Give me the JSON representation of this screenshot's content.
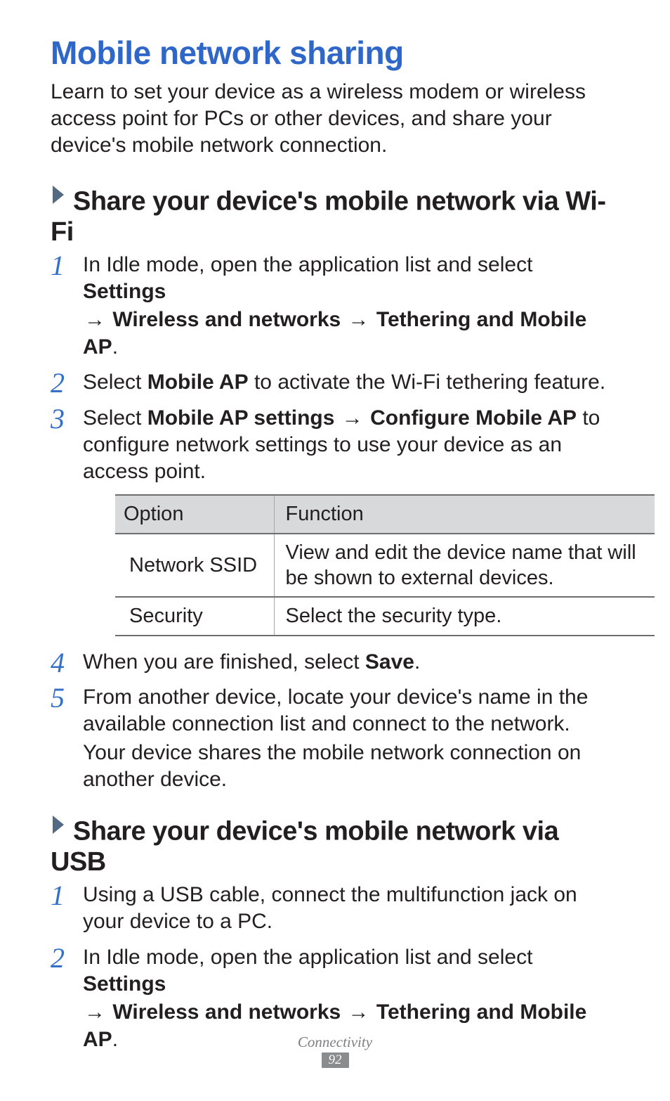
{
  "title": "Mobile network sharing",
  "intro": "Learn to set your device as a wireless modem or wireless access point for PCs or other devices, and share your device's mobile network connection.",
  "section1": {
    "heading": "Share your device's mobile network via Wi-Fi",
    "steps": {
      "s1_a": "In Idle mode, open the application list and select ",
      "s1_b": "Settings",
      "s1_c": "Wireless and networks",
      "s1_d": "Tethering and Mobile AP",
      "s1_e": ".",
      "s2_a": "Select ",
      "s2_b": "Mobile AP",
      "s2_c": " to activate the Wi-Fi tethering feature.",
      "s3_a": "Select ",
      "s3_b": "Mobile AP settings",
      "s3_c": "Configure Mobile AP",
      "s3_d": " to configure network settings to use your device as an access point.",
      "s4": "When you are finished, select ",
      "s4_b": "Save",
      "s4_c": ".",
      "s5_a": "From another device, locate your device's name in the available connection list and connect to the network.",
      "s5_b": "Your device shares the mobile network connection on another device."
    },
    "nums": {
      "n1": "1",
      "n2": "2",
      "n3": "3",
      "n4": "4",
      "n5": "5"
    }
  },
  "table": {
    "head": {
      "c1": "Option",
      "c2": "Function"
    },
    "rows": [
      {
        "c1": "Network SSID",
        "c2": "View and edit the device name that will be shown to external devices."
      },
      {
        "c1": "Security",
        "c2": "Select the security type."
      }
    ]
  },
  "section2": {
    "heading": "Share your device's mobile network via USB",
    "steps": {
      "s1": "Using a USB cable, connect the multifunction jack on your device to a PC.",
      "s2_a": "In Idle mode, open the application list and select ",
      "s2_b": "Settings",
      "s2_c": "Wireless and networks",
      "s2_d": "Tethering and Mobile AP",
      "s2_e": "."
    },
    "nums": {
      "n1": "1",
      "n2": "2"
    }
  },
  "arrow": "→",
  "footer": {
    "category": "Connectivity",
    "page": "92"
  }
}
